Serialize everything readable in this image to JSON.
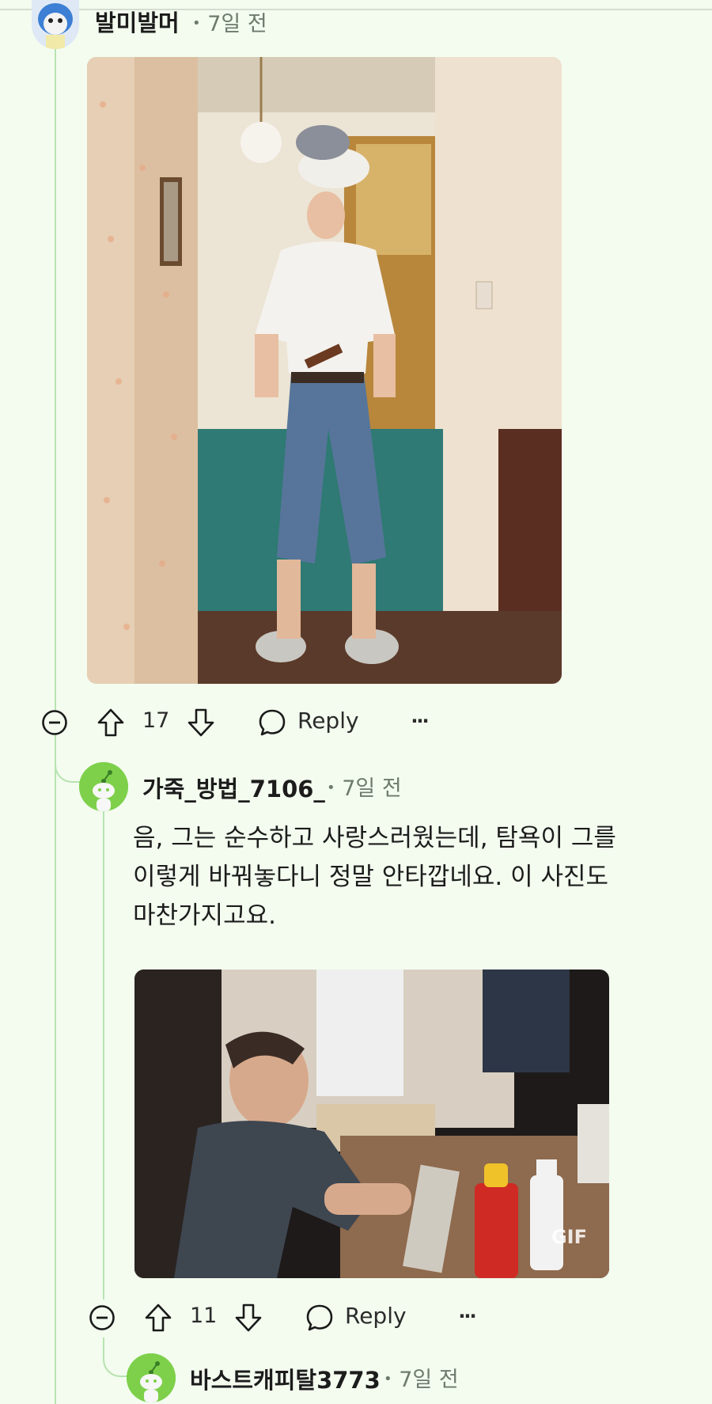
{
  "comments": [
    {
      "username": "발미발머",
      "time": "7일 전",
      "upvotes": "17",
      "reply_label": "Reply",
      "more_label": "···"
    },
    {
      "username": "가죽_방법_7106_",
      "time": "7일 전",
      "body_lines": [
        "음, 그는 순수하고 사랑스러웠는데, 탐욕이 그를",
        "이렇게 바꿔놓다니 정말 안타깝네요. 이 사진도",
        "마찬가지고요."
      ],
      "gif_badge": "GIF",
      "upvotes": "11",
      "reply_label": "Reply",
      "more_label": "···"
    },
    {
      "username": "바스트캐피탈3773",
      "time": "7일 전"
    }
  ],
  "colors": {
    "background": "#f3fcef",
    "thread_line": "#b7e3b0",
    "snoo_green": "#7ed04b"
  },
  "meta_separator": "•"
}
